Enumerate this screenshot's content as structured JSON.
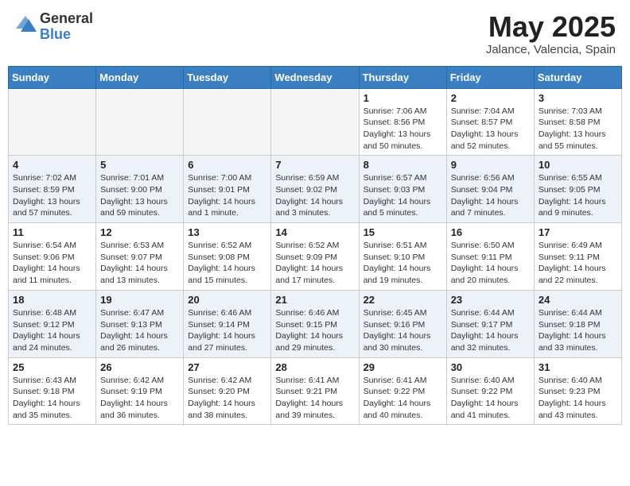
{
  "header": {
    "logo_general": "General",
    "logo_blue": "Blue",
    "month_title": "May 2025",
    "location": "Jalance, Valencia, Spain"
  },
  "days_of_week": [
    "Sunday",
    "Monday",
    "Tuesday",
    "Wednesday",
    "Thursday",
    "Friday",
    "Saturday"
  ],
  "weeks": [
    [
      {
        "day": "",
        "info": ""
      },
      {
        "day": "",
        "info": ""
      },
      {
        "day": "",
        "info": ""
      },
      {
        "day": "",
        "info": ""
      },
      {
        "day": "1",
        "info": "Sunrise: 7:06 AM\nSunset: 8:56 PM\nDaylight: 13 hours\nand 50 minutes."
      },
      {
        "day": "2",
        "info": "Sunrise: 7:04 AM\nSunset: 8:57 PM\nDaylight: 13 hours\nand 52 minutes."
      },
      {
        "day": "3",
        "info": "Sunrise: 7:03 AM\nSunset: 8:58 PM\nDaylight: 13 hours\nand 55 minutes."
      }
    ],
    [
      {
        "day": "4",
        "info": "Sunrise: 7:02 AM\nSunset: 8:59 PM\nDaylight: 13 hours\nand 57 minutes."
      },
      {
        "day": "5",
        "info": "Sunrise: 7:01 AM\nSunset: 9:00 PM\nDaylight: 13 hours\nand 59 minutes."
      },
      {
        "day": "6",
        "info": "Sunrise: 7:00 AM\nSunset: 9:01 PM\nDaylight: 14 hours\nand 1 minute."
      },
      {
        "day": "7",
        "info": "Sunrise: 6:59 AM\nSunset: 9:02 PM\nDaylight: 14 hours\nand 3 minutes."
      },
      {
        "day": "8",
        "info": "Sunrise: 6:57 AM\nSunset: 9:03 PM\nDaylight: 14 hours\nand 5 minutes."
      },
      {
        "day": "9",
        "info": "Sunrise: 6:56 AM\nSunset: 9:04 PM\nDaylight: 14 hours\nand 7 minutes."
      },
      {
        "day": "10",
        "info": "Sunrise: 6:55 AM\nSunset: 9:05 PM\nDaylight: 14 hours\nand 9 minutes."
      }
    ],
    [
      {
        "day": "11",
        "info": "Sunrise: 6:54 AM\nSunset: 9:06 PM\nDaylight: 14 hours\nand 11 minutes."
      },
      {
        "day": "12",
        "info": "Sunrise: 6:53 AM\nSunset: 9:07 PM\nDaylight: 14 hours\nand 13 minutes."
      },
      {
        "day": "13",
        "info": "Sunrise: 6:52 AM\nSunset: 9:08 PM\nDaylight: 14 hours\nand 15 minutes."
      },
      {
        "day": "14",
        "info": "Sunrise: 6:52 AM\nSunset: 9:09 PM\nDaylight: 14 hours\nand 17 minutes."
      },
      {
        "day": "15",
        "info": "Sunrise: 6:51 AM\nSunset: 9:10 PM\nDaylight: 14 hours\nand 19 minutes."
      },
      {
        "day": "16",
        "info": "Sunrise: 6:50 AM\nSunset: 9:11 PM\nDaylight: 14 hours\nand 20 minutes."
      },
      {
        "day": "17",
        "info": "Sunrise: 6:49 AM\nSunset: 9:11 PM\nDaylight: 14 hours\nand 22 minutes."
      }
    ],
    [
      {
        "day": "18",
        "info": "Sunrise: 6:48 AM\nSunset: 9:12 PM\nDaylight: 14 hours\nand 24 minutes."
      },
      {
        "day": "19",
        "info": "Sunrise: 6:47 AM\nSunset: 9:13 PM\nDaylight: 14 hours\nand 26 minutes."
      },
      {
        "day": "20",
        "info": "Sunrise: 6:46 AM\nSunset: 9:14 PM\nDaylight: 14 hours\nand 27 minutes."
      },
      {
        "day": "21",
        "info": "Sunrise: 6:46 AM\nSunset: 9:15 PM\nDaylight: 14 hours\nand 29 minutes."
      },
      {
        "day": "22",
        "info": "Sunrise: 6:45 AM\nSunset: 9:16 PM\nDaylight: 14 hours\nand 30 minutes."
      },
      {
        "day": "23",
        "info": "Sunrise: 6:44 AM\nSunset: 9:17 PM\nDaylight: 14 hours\nand 32 minutes."
      },
      {
        "day": "24",
        "info": "Sunrise: 6:44 AM\nSunset: 9:18 PM\nDaylight: 14 hours\nand 33 minutes."
      }
    ],
    [
      {
        "day": "25",
        "info": "Sunrise: 6:43 AM\nSunset: 9:18 PM\nDaylight: 14 hours\nand 35 minutes."
      },
      {
        "day": "26",
        "info": "Sunrise: 6:42 AM\nSunset: 9:19 PM\nDaylight: 14 hours\nand 36 minutes."
      },
      {
        "day": "27",
        "info": "Sunrise: 6:42 AM\nSunset: 9:20 PM\nDaylight: 14 hours\nand 38 minutes."
      },
      {
        "day": "28",
        "info": "Sunrise: 6:41 AM\nSunset: 9:21 PM\nDaylight: 14 hours\nand 39 minutes."
      },
      {
        "day": "29",
        "info": "Sunrise: 6:41 AM\nSunset: 9:22 PM\nDaylight: 14 hours\nand 40 minutes."
      },
      {
        "day": "30",
        "info": "Sunrise: 6:40 AM\nSunset: 9:22 PM\nDaylight: 14 hours\nand 41 minutes."
      },
      {
        "day": "31",
        "info": "Sunrise: 6:40 AM\nSunset: 9:23 PM\nDaylight: 14 hours\nand 43 minutes."
      }
    ]
  ]
}
